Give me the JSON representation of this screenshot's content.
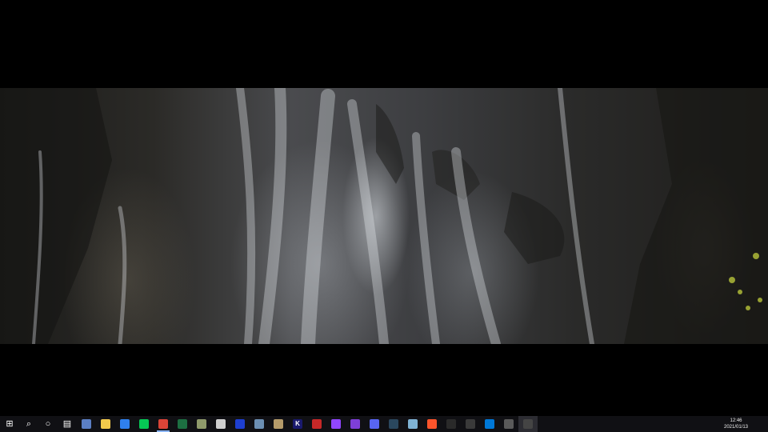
{
  "taskbar": {
    "apps": [
      {
        "name": "start-icon",
        "label": "⊞",
        "color": "#ffffff",
        "kind": "glyph"
      },
      {
        "name": "search-icon",
        "label": "⌕",
        "color": "#ffffff",
        "kind": "glyph"
      },
      {
        "name": "cortana-icon",
        "label": "○",
        "color": "#ffffff",
        "kind": "glyph"
      },
      {
        "name": "task-view-icon",
        "label": "▤",
        "color": "#ffffff",
        "kind": "glyph"
      },
      {
        "name": "calculator-icon",
        "label": "",
        "color": "#5b7fc4"
      },
      {
        "name": "file-explorer-icon",
        "label": "",
        "color": "#f2c94c"
      },
      {
        "name": "mail-icon",
        "label": "",
        "color": "#2f80ed"
      },
      {
        "name": "line-icon",
        "label": "",
        "color": "#06c755"
      },
      {
        "name": "chrome-icon",
        "label": "",
        "color": "#db4437",
        "running": true
      },
      {
        "name": "excel-icon",
        "label": "",
        "color": "#1d6f42"
      },
      {
        "name": "paint-icon",
        "label": "",
        "color": "#8f9a6b"
      },
      {
        "name": "photo-viewer-icon",
        "label": "",
        "color": "#cfcfcf"
      },
      {
        "name": "monitor-icon",
        "label": "",
        "color": "#1e3fd0"
      },
      {
        "name": "app-icon-11",
        "label": "",
        "color": "#6c8fb3"
      },
      {
        "name": "app-icon-12",
        "label": "",
        "color": "#b59b6a"
      },
      {
        "name": "k-app-icon",
        "label": "K",
        "color": "#1a1a6e"
      },
      {
        "name": "red-arrow-app-icon",
        "label": "",
        "color": "#c62828"
      },
      {
        "name": "twitch-icon",
        "label": "",
        "color": "#9146ff"
      },
      {
        "name": "twitch-alt-icon",
        "label": "",
        "color": "#7e3fd8"
      },
      {
        "name": "chat-app-icon",
        "label": "",
        "color": "#5865f2"
      },
      {
        "name": "steam-icon",
        "label": "",
        "color": "#2a475e"
      },
      {
        "name": "notes-app-icon",
        "label": "",
        "color": "#7fb3d5"
      },
      {
        "name": "brave-icon",
        "label": "",
        "color": "#fb542b"
      },
      {
        "name": "epic-games-icon",
        "label": "",
        "color": "#2a2a2a"
      },
      {
        "name": "app-icon-24",
        "label": "",
        "color": "#3a3a3a"
      },
      {
        "name": "edge-icon",
        "label": "",
        "color": "#0078d7"
      },
      {
        "name": "xbox-icon",
        "label": "",
        "color": "#5a5a5a"
      },
      {
        "name": "obs-icon",
        "label": "",
        "color": "#444444",
        "active": true
      }
    ]
  },
  "tray": {
    "time": "12:46",
    "date": "2021/01/13"
  }
}
